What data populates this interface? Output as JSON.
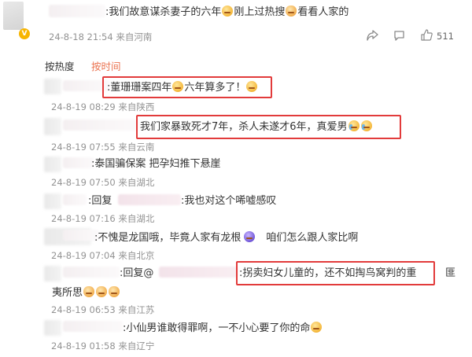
{
  "top_post": {
    "text": ":我们故意谋杀妻子的六年",
    "text_after_emoji": "刚上过热搜",
    "text_tail": "看看人家的",
    "meta": "24-8-18 21:54 来自河南",
    "like_count": "511"
  },
  "sort_tabs": {
    "hot": "按热度",
    "time": "按时间"
  },
  "replies": [
    {
      "text": ":董珊珊案四年",
      "text_mid": "六年算多了！",
      "meta": "24-8-19 08:29 来自陕西"
    },
    {
      "text": "我们家暴致死才7年，杀人未遂才6年，真爱男",
      "meta": "24-8-19 07:55 来自云南"
    },
    {
      "text": ":泰国骗保案 把孕妇推下悬崖",
      "meta": "24-8-19 07:50 来自湖北"
    },
    {
      "prefix": ":回复",
      "text": ":我也对这个唏嘘感叹",
      "meta": "24-8-19 07:16 来自湖北"
    },
    {
      "text": ":不愧是龙国哦，毕竟人家有龙根",
      "text_tail": "咱们怎么跟人家比啊",
      "meta": "24-8-19 07:04 来自北京"
    },
    {
      "prefix": ":回复@",
      "text": ":拐卖妇女儿童的，还不如掏鸟窝判的重",
      "text_tail": "匪",
      "text_line2": "夷所思",
      "meta": "24-8-19 06:53 来自江苏"
    },
    {
      "text": ":小仙男谁敢得罪啊，一不小心要了你的命",
      "meta": "24-8-19 01:58 来自辽宁"
    }
  ],
  "icons": {
    "share": "share-icon",
    "comment": "comment-icon",
    "like": "thumbs-up-icon"
  },
  "colors": {
    "accent": "#eb7350",
    "highlight_box": "#e23b3b",
    "meta_gray": "#939393"
  }
}
